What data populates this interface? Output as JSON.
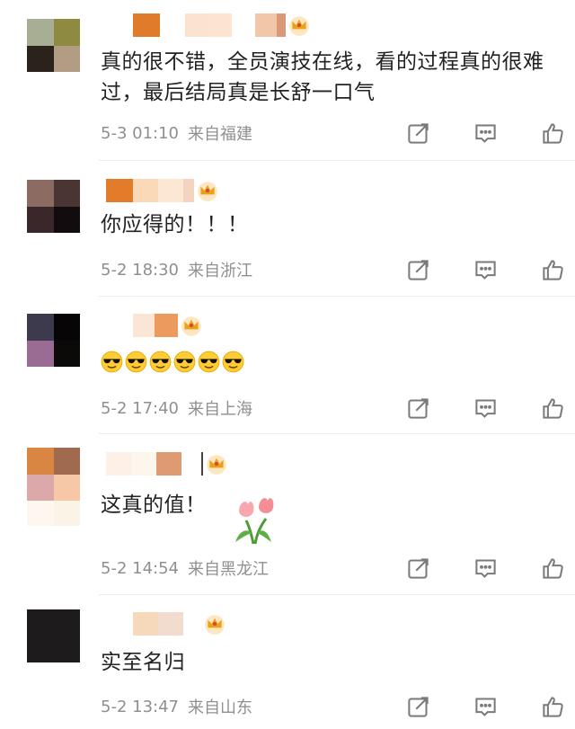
{
  "comments": [
    {
      "text": "真的很不错，全员演技在线，看的过程真的很难过，最后结局真是长舒一口气",
      "time": "5-3 01:10",
      "location": "来自福建"
    },
    {
      "text": "你应得的！！！",
      "time": "5-2 18:30",
      "location": "来自浙江"
    },
    {
      "text": "",
      "emoji_icon": "sunglasses-emoji",
      "emoji_count": 6,
      "time": "5-2 17:40",
      "location": "来自上海"
    },
    {
      "text": "这真的值！",
      "sticker_icon": "tulip-sticker",
      "time": "5-2 14:54",
      "location": "来自黑龙江"
    },
    {
      "text": "实至名归",
      "time": "5-2 13:47",
      "location": "来自山东"
    }
  ],
  "icons": {
    "share": "share-icon",
    "reply": "comment-icon",
    "like": "thumbs-up-icon",
    "badge": "crown-badge-icon"
  },
  "colors": {
    "text": "#222222",
    "meta": "#8f8f8f",
    "icon": "#7a7a7a",
    "crown": "#e8a21a"
  }
}
